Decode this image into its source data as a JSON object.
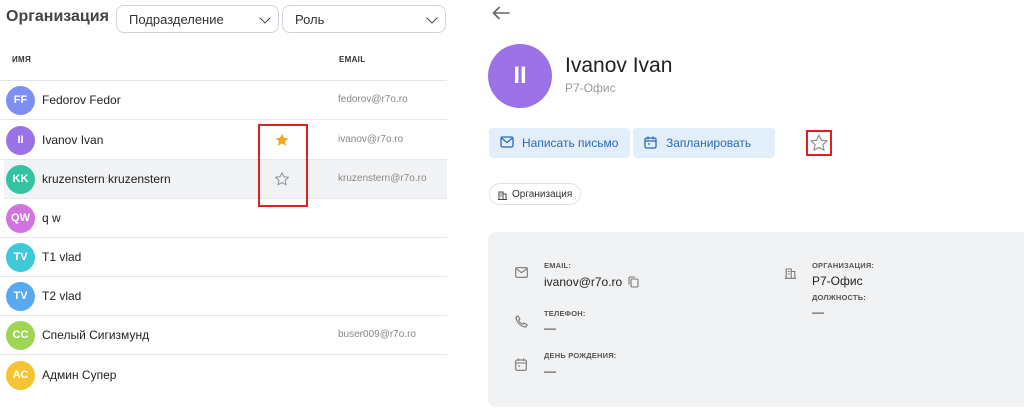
{
  "toolbar": {
    "title": "Организация",
    "filter_department": "Подразделение",
    "filter_role": "Роль"
  },
  "table": {
    "col_name": "ИМЯ",
    "col_email": "EMAIL",
    "rows": [
      {
        "initials": "FF",
        "name": "Fedorov Fedor",
        "email": "fedorov@r7o.ro",
        "color": "#7d8ff0",
        "star": "none"
      },
      {
        "initials": "II",
        "name": "Ivanov Ivan",
        "email": "ivanov@r7o.ro",
        "color": "#9a72e6",
        "star": "filled"
      },
      {
        "initials": "KK",
        "name": "kruzenstern kruzenstern",
        "email": "kruzenstern@r7o.ro",
        "color": "#33c2a4",
        "star": "outline"
      },
      {
        "initials": "QW",
        "name": "q w",
        "email": "",
        "color": "#d274e0",
        "star": "none"
      },
      {
        "initials": "TV",
        "name": "T1 vlad",
        "email": "",
        "color": "#3ec8d8",
        "star": "none"
      },
      {
        "initials": "TV",
        "name": "T2 vlad",
        "email": "",
        "color": "#57a9f0",
        "star": "none"
      },
      {
        "initials": "СС",
        "name": "Спелый Сигизмунд",
        "email": "buser009@r7o.ro",
        "color": "#9ed553",
        "star": "none"
      },
      {
        "initials": "АС",
        "name": "Админ Супер",
        "email": "",
        "color": "#f5c430",
        "star": "none"
      }
    ]
  },
  "profile": {
    "initials": "II",
    "name": "Ivanov Ivan",
    "company": "Р7-Офис",
    "write_button": "Написать письмо",
    "plan_button": "Запланировать",
    "chip": "Организация",
    "email_label": "EMAIL:",
    "email_value": "ivanov@r7o.ro",
    "phone_label": "ТЕЛЕФОН:",
    "phone_value": "—",
    "birthday_label": "ДЕНЬ РОЖДЕНИЯ:",
    "birthday_value": "—",
    "org_label": "ОРГАНИЗАЦИЯ:",
    "org_value": "Р7-Офис",
    "position_label": "ДОЛЖНОСТЬ:",
    "position_value": "—"
  },
  "colors": {
    "accent": "#2a6bb8",
    "button_bg": "#e2eef9",
    "highlight_box": "#e02020",
    "star_filled": "#f5a623"
  }
}
